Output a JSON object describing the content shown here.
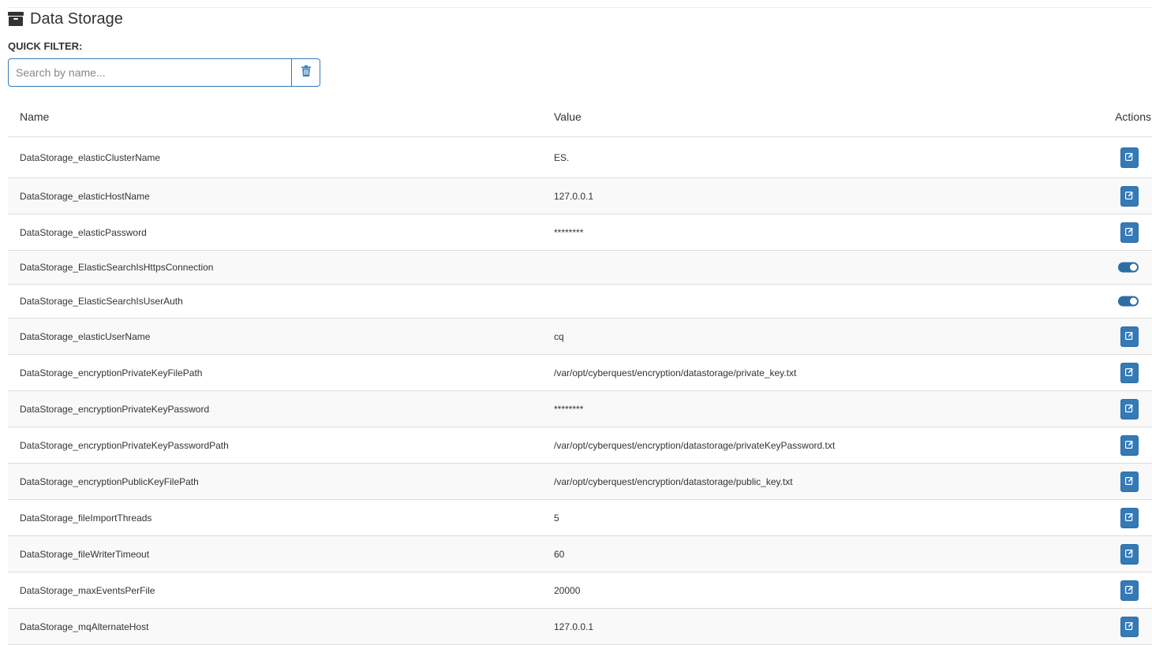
{
  "header": {
    "title": "Data Storage",
    "icon": "archive-icon"
  },
  "filter": {
    "label": "QUICK FILTER:",
    "placeholder": "Search by name...",
    "value": "",
    "clear_icon": "trash-icon"
  },
  "table": {
    "columns": {
      "name": "Name",
      "value": "Value",
      "actions": "Actions"
    },
    "rows": [
      {
        "name": "DataStorage_elasticClusterName",
        "value": "ES.",
        "action": "edit"
      },
      {
        "name": "DataStorage_elasticHostName",
        "value": "127.0.0.1",
        "action": "edit"
      },
      {
        "name": "DataStorage_elasticPassword",
        "value": "********",
        "action": "edit"
      },
      {
        "name": "DataStorage_ElasticSearchIsHttpsConnection",
        "value": "",
        "action": "toggle",
        "toggle_on": true
      },
      {
        "name": "DataStorage_ElasticSearchIsUserAuth",
        "value": "",
        "action": "toggle",
        "toggle_on": true
      },
      {
        "name": "DataStorage_elasticUserName",
        "value": "cq",
        "action": "edit"
      },
      {
        "name": "DataStorage_encryptionPrivateKeyFilePath",
        "value": "/var/opt/cyberquest/encryption/datastorage/private_key.txt",
        "action": "edit"
      },
      {
        "name": "DataStorage_encryptionPrivateKeyPassword",
        "value": "********",
        "action": "edit"
      },
      {
        "name": "DataStorage_encryptionPrivateKeyPasswordPath",
        "value": "/var/opt/cyberquest/encryption/datastorage/privateKeyPassword.txt",
        "action": "edit"
      },
      {
        "name": "DataStorage_encryptionPublicKeyFilePath",
        "value": "/var/opt/cyberquest/encryption/datastorage/public_key.txt",
        "action": "edit"
      },
      {
        "name": "DataStorage_fileImportThreads",
        "value": "5",
        "action": "edit"
      },
      {
        "name": "DataStorage_fileWriterTimeout",
        "value": "60",
        "action": "edit"
      },
      {
        "name": "DataStorage_maxEventsPerFile",
        "value": "20000",
        "action": "edit"
      },
      {
        "name": "DataStorage_mqAlternateHost",
        "value": "127.0.0.1",
        "action": "edit"
      }
    ]
  },
  "colors": {
    "primary": "#337ab7",
    "row_stripe": "#f9f9f9",
    "border": "#dddddd"
  }
}
